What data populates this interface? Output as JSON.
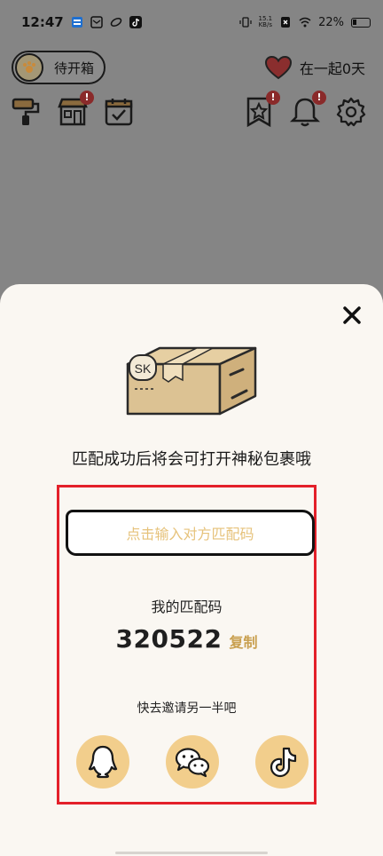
{
  "status_bar": {
    "time": "12:47",
    "net_speed_value": "15.1",
    "net_speed_unit": "KB/s",
    "battery": "22%"
  },
  "header": {
    "pet_label": "待开箱",
    "days_label": "在一起0天",
    "badge_mark": "!"
  },
  "sheet": {
    "box_mark": "SK",
    "headline": "匹配成功后将会可打开神秘包裹哦",
    "input_placeholder": "点击输入对方匹配码",
    "my_code_label": "我的匹配码",
    "my_code": "320522",
    "copy_label": "复制",
    "invite_text": "快去邀请另一半吧",
    "share_targets": [
      "qq-icon",
      "wechat-icon",
      "tiktok-icon"
    ]
  },
  "colors": {
    "accent_gold": "#c9a050",
    "placeholder_gold": "#e6c27a",
    "share_bg": "#f2ce8c",
    "highlight_red": "#e3202a",
    "dim_overlay": "#858585"
  }
}
